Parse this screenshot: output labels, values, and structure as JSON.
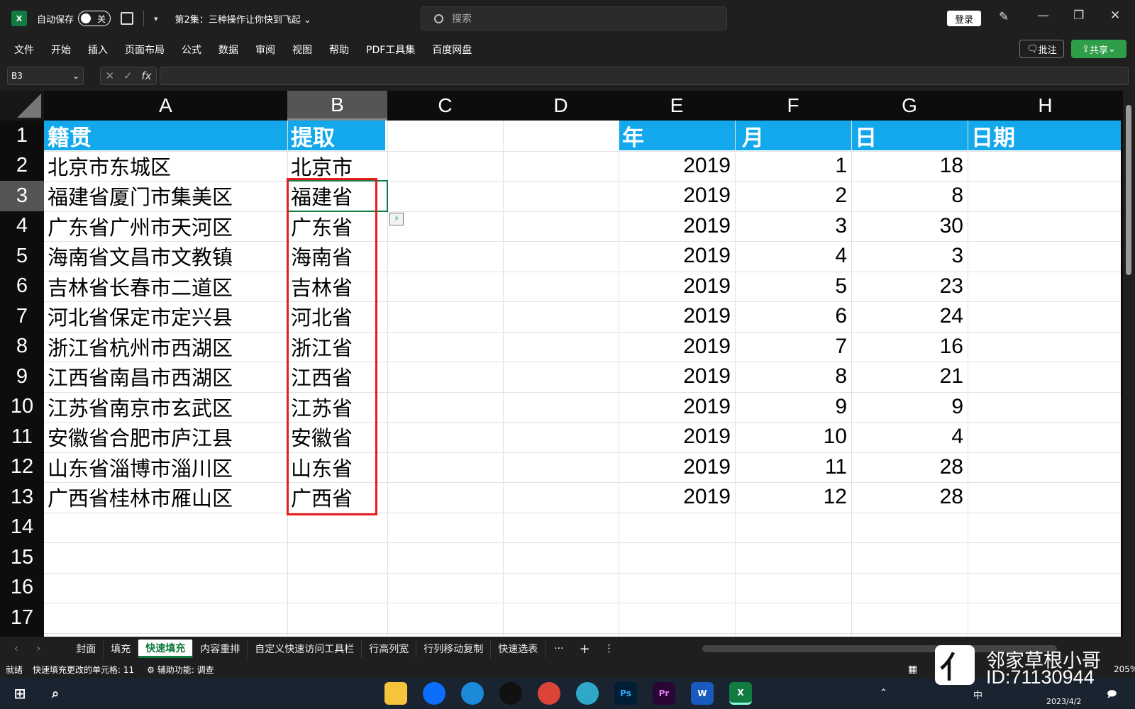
{
  "titlebar": {
    "autosave_label": "自动保存",
    "toggle_state": "关",
    "doc_title": "第2集：三种操作让你快到飞起",
    "search_placeholder": "搜索",
    "login": "登录"
  },
  "menu": [
    "文件",
    "开始",
    "插入",
    "页面布局",
    "公式",
    "数据",
    "审阅",
    "视图",
    "帮助",
    "PDF工具集",
    "百度网盘"
  ],
  "buttons": {
    "comments": "批注",
    "share": "共享"
  },
  "formula": {
    "name_box": "B3",
    "fx": "fx"
  },
  "columns": [
    "A",
    "B",
    "C",
    "D",
    "E",
    "F",
    "G",
    "H"
  ],
  "rows": [
    "1",
    "2",
    "3",
    "4",
    "5",
    "6",
    "7",
    "8",
    "9",
    "10",
    "11",
    "12",
    "13",
    "14",
    "15",
    "16",
    "17"
  ],
  "headers": {
    "a": "籍贯",
    "b": "提取",
    "e": "年",
    "f": "月",
    "g": "日",
    "h": "日期"
  },
  "col_a": [
    "北京市东城区",
    "福建省厦门市集美区",
    "广东省广州市天河区",
    "海南省文昌市文教镇",
    "吉林省长春市二道区",
    "河北省保定市定兴县",
    "浙江省杭州市西湖区",
    "江西省南昌市西湖区",
    "江苏省南京市玄武区",
    "安徽省合肥市庐江县",
    "山东省淄博市淄川区",
    "广西省桂林市雁山区"
  ],
  "col_b": [
    "北京市",
    "福建省",
    "广东省",
    "海南省",
    "吉林省",
    "河北省",
    "浙江省",
    "江西省",
    "江苏省",
    "安徽省",
    "山东省",
    "广西省"
  ],
  "col_e": [
    "2019",
    "2019",
    "2019",
    "2019",
    "2019",
    "2019",
    "2019",
    "2019",
    "2019",
    "2019",
    "2019",
    "2019"
  ],
  "col_f": [
    "1",
    "2",
    "3",
    "4",
    "5",
    "6",
    "7",
    "8",
    "9",
    "10",
    "11",
    "12"
  ],
  "col_g": [
    "18",
    "8",
    "30",
    "3",
    "23",
    "24",
    "16",
    "21",
    "9",
    "4",
    "28",
    "28"
  ],
  "sheet_tabs": [
    "封面",
    "填充",
    "快速填充",
    "内容重排",
    "自定义快速访问工具栏",
    "行高列宽",
    "行列移动复制",
    "快速选表"
  ],
  "active_tab": "快速填充",
  "tab_more": "···",
  "tab_add": "+",
  "status": {
    "ready": "就绪",
    "flash_fill": "快速填充更改的单元格: 11",
    "accessibility": "辅助功能: 调查",
    "zoom": "205%"
  },
  "watermark": {
    "name": "邻家草根小哥",
    "id": "ID:71130944"
  },
  "tray": {
    "ime": "中",
    "date": "2023/4/2"
  },
  "colors": {
    "header_band": "#13a7eb",
    "highlight_box": "#e81b1b",
    "excel_green": "#107c41"
  }
}
